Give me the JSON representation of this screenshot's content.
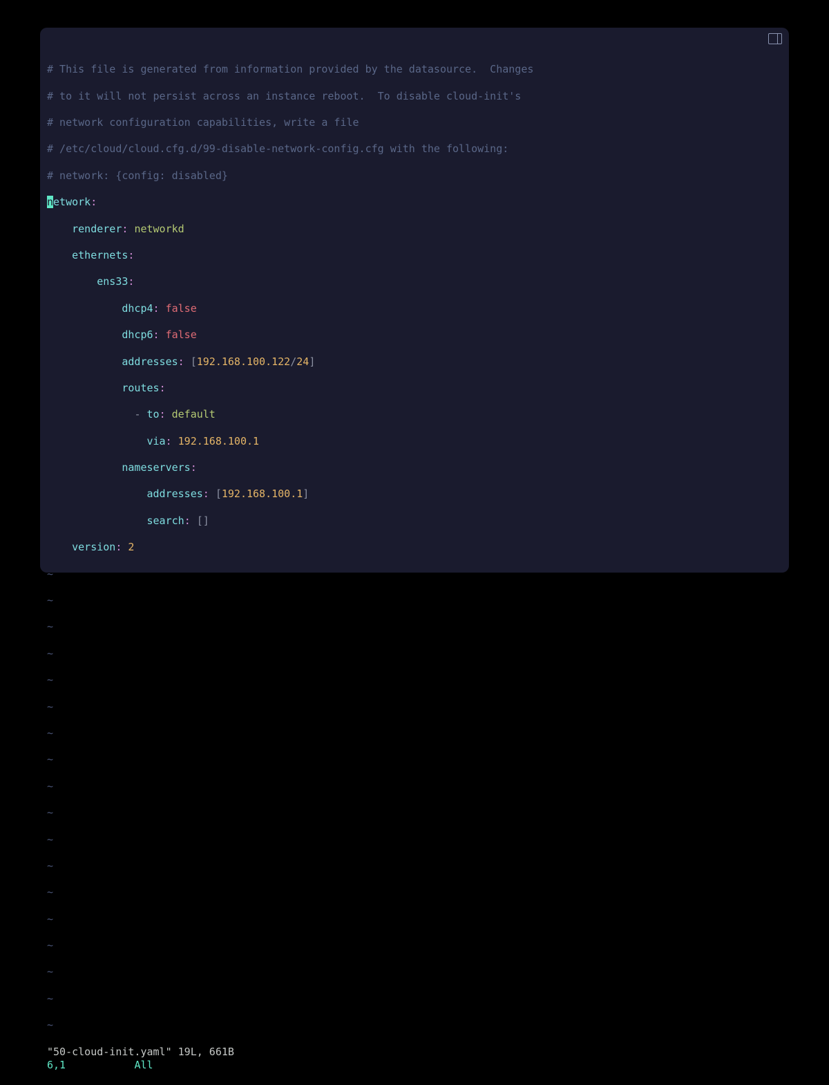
{
  "comments": {
    "c1": "# This file is generated from information provided by the datasource.  Changes",
    "c2": "# to it will not persist across an instance reboot.  To disable cloud-init's",
    "c3": "# network configuration capabilities, write a file",
    "c4": "# /etc/cloud/cloud.cfg.d/99-disable-network-config.cfg with the following:",
    "c5": "# network: {config: disabled}"
  },
  "yaml": {
    "cursor_char": "n",
    "network_rest": "etwork",
    "renderer_key": "renderer",
    "renderer_val": "networkd",
    "ethernets_key": "ethernets",
    "iface_key": "ens33",
    "dhcp4_key": "dhcp4",
    "dhcp4_val": "false",
    "dhcp6_key": "dhcp6",
    "dhcp6_val": "false",
    "addresses_key": "addresses",
    "addr_ip": "192.168.100.122",
    "addr_slash": "/",
    "addr_prefix": "24",
    "routes_key": "routes",
    "route_dash": "- ",
    "route_to_key": "to",
    "route_to_val": "default",
    "route_via_key": "via",
    "route_via_val": "192.168.100.1",
    "nameservers_key": "nameservers",
    "ns_addresses_key": "addresses",
    "ns_addr_val": "192.168.100.1",
    "search_key": "search",
    "search_val": "[]",
    "version_key": "version",
    "version_val": "2"
  },
  "tilde": "~",
  "status": {
    "file": "\"50-cloud-init.yaml\" 19L, 661B",
    "pos": "6,1",
    "gap": "           ",
    "all": "All"
  }
}
